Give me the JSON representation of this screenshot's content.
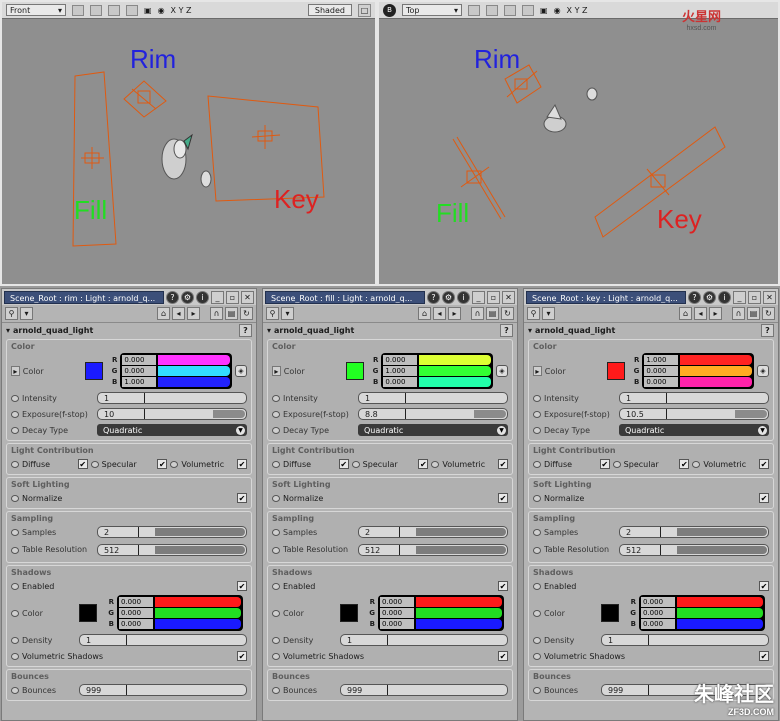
{
  "logo": {
    "text": "火星网",
    "sub": "hxsd.com"
  },
  "watermark": {
    "text": "朱峰社区",
    "sub": "ZF3D.COM"
  },
  "viewports": [
    {
      "view": "Front",
      "axes": "X Y Z",
      "shading": "Shaded",
      "labels": {
        "rim": "Rim",
        "fill": "Fill",
        "key": "Key"
      }
    },
    {
      "view": "Top",
      "badge": "B",
      "axes": "X Y Z",
      "labels": {
        "rim": "Rim",
        "fill": "Fill",
        "key": "Key"
      }
    }
  ],
  "panels": [
    {
      "title": "Scene_Root : rim : Light : arnold_q...",
      "node": "arnold_quad_light",
      "help": "?",
      "color": {
        "section": "Color",
        "label": "Color",
        "swatch": "#1a1aff",
        "r": "0.000",
        "g": "0.000",
        "b": "1.000",
        "r_grad": "#ff33ff",
        "g_grad": "#33ddff",
        "b_grad": "#2222ff",
        "mode": "RGB"
      },
      "intensity": {
        "label": "Intensity",
        "value": "1"
      },
      "exposure": {
        "label": "Exposure(f-stop)",
        "value": "10"
      },
      "decay": {
        "label": "Decay Type",
        "value": "Quadratic"
      },
      "light_contribution": {
        "section": "Light Contribution",
        "diffuse": "Diffuse",
        "specular": "Specular",
        "volumetric": "Volumetric"
      },
      "soft_lighting": {
        "section": "Soft Lighting",
        "normalize": "Normalize"
      },
      "sampling": {
        "section": "Sampling",
        "samples_label": "Samples",
        "samples": "2",
        "table_label": "Table Resolution",
        "table": "512"
      },
      "shadows": {
        "section": "Shadows",
        "enabled": "Enabled",
        "color_label": "Color",
        "swatch": "#000000",
        "r": "0.000",
        "g": "0.000",
        "b": "0.000",
        "mode": "RGB",
        "density_label": "Density",
        "density": "1",
        "vol_label": "Volumetric Shadows"
      },
      "bounces": {
        "section": "Bounces",
        "label": "Bounces",
        "value": "999"
      }
    },
    {
      "title": "Scene_Root : fill : Light : arnold_q...",
      "node": "arnold_quad_light",
      "help": "?",
      "color": {
        "section": "Color",
        "label": "Color",
        "swatch": "#22ff22",
        "r": "0.000",
        "g": "1.000",
        "b": "0.000",
        "r_grad": "#ddff33",
        "g_grad": "#33ff33",
        "b_grad": "#22ffaa",
        "mode": "RGB"
      },
      "intensity": {
        "label": "Intensity",
        "value": "1"
      },
      "exposure": {
        "label": "Exposure(f-stop)",
        "value": "8.8"
      },
      "decay": {
        "label": "Decay Type",
        "value": "Quadratic"
      },
      "light_contribution": {
        "section": "Light Contribution",
        "diffuse": "Diffuse",
        "specular": "Specular",
        "volumetric": "Volumetric"
      },
      "soft_lighting": {
        "section": "Soft Lighting",
        "normalize": "Normalize"
      },
      "sampling": {
        "section": "Sampling",
        "samples_label": "Samples",
        "samples": "2",
        "table_label": "Table Resolution",
        "table": "512"
      },
      "shadows": {
        "section": "Shadows",
        "enabled": "Enabled",
        "color_label": "Color",
        "swatch": "#000000",
        "r": "0.000",
        "g": "0.000",
        "b": "0.000",
        "mode": "RGB",
        "density_label": "Density",
        "density": "1",
        "vol_label": "Volumetric Shadows"
      },
      "bounces": {
        "section": "Bounces",
        "label": "Bounces",
        "value": "999"
      }
    },
    {
      "title": "Scene_Root : key : Light : arnold_q...",
      "node": "arnold_quad_light",
      "help": "?",
      "color": {
        "section": "Color",
        "label": "Color",
        "swatch": "#ff1a1a",
        "r": "1.000",
        "g": "0.000",
        "b": "0.000",
        "r_grad": "#ff2222",
        "g_grad": "#ffaa22",
        "b_grad": "#ff22aa",
        "mode": "RGB"
      },
      "intensity": {
        "label": "Intensity",
        "value": "1"
      },
      "exposure": {
        "label": "Exposure(f-stop)",
        "value": "10.5"
      },
      "decay": {
        "label": "Decay Type",
        "value": "Quadratic"
      },
      "light_contribution": {
        "section": "Light Contribution",
        "diffuse": "Diffuse",
        "specular": "Specular",
        "volumetric": "Volumetric"
      },
      "soft_lighting": {
        "section": "Soft Lighting",
        "normalize": "Normalize"
      },
      "sampling": {
        "section": "Sampling",
        "samples_label": "Samples",
        "samples": "2",
        "table_label": "Table Resolution",
        "table": "512"
      },
      "shadows": {
        "section": "Shadows",
        "enabled": "Enabled",
        "color_label": "Color",
        "swatch": "#000000",
        "r": "0.000",
        "g": "0.000",
        "b": "0.000",
        "mode": "RGB",
        "density_label": "Density",
        "density": "1",
        "vol_label": "Volumetric Shadows"
      },
      "bounces": {
        "section": "Bounces",
        "label": "Bounces",
        "value": "999"
      }
    }
  ],
  "check_mark": "✔"
}
